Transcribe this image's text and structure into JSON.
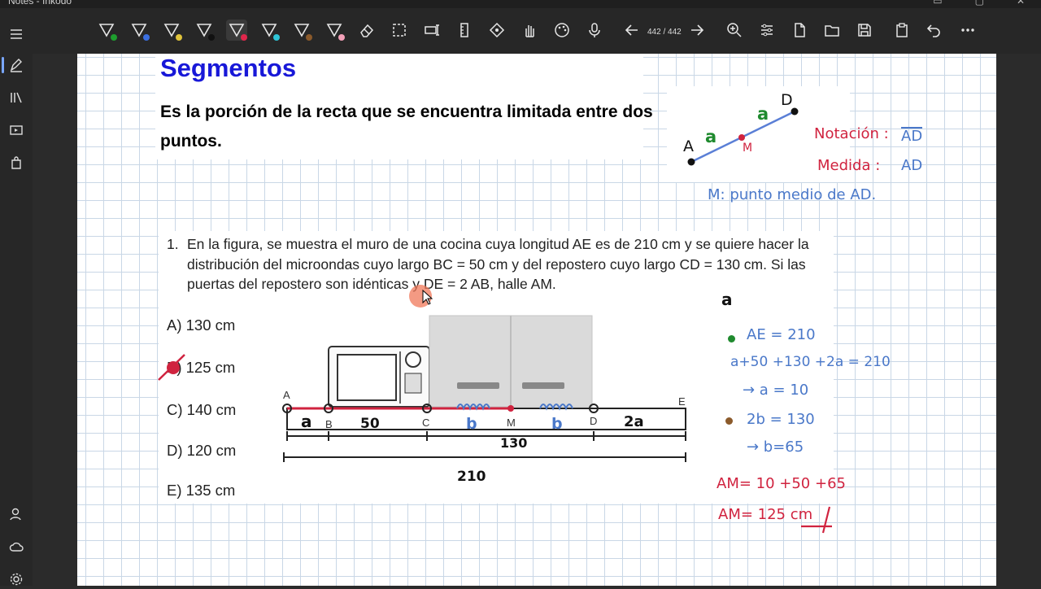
{
  "window": {
    "title": "Notes - Inkodo"
  },
  "toolbar": {
    "pens": [
      {
        "icon": "pen-icon",
        "color": "#1e9e2e"
      },
      {
        "icon": "pen-icon",
        "color": "#3b6fe0"
      },
      {
        "icon": "pen-icon",
        "color": "#e0c33b"
      },
      {
        "icon": "pen-icon",
        "color": "#111111"
      },
      {
        "icon": "pen-icon",
        "color": "#e0264b"
      },
      {
        "icon": "pen-icon",
        "color": "#2ec4d6"
      },
      {
        "icon": "pen-icon",
        "color": "#8b5a2b"
      },
      {
        "icon": "pen-icon",
        "color": "#f2a0b8"
      }
    ],
    "page_indicator": "442 / 442"
  },
  "content": {
    "heading": "Segmentos",
    "definition": "Es la porción de la recta que se encuentra limitada entre dos puntos.",
    "question_number": "1.",
    "question_text": "En la figura, se muestra el muro de una cocina cuya longitud AE es de 210 cm y se quiere hacer la distribución del microondas cuyo largo BC = 50 cm y del repostero cuyo largo CD = 130 cm. Si las puertas del repostero son idénticas y DE = 2 AB, halle AM.",
    "options": [
      {
        "letter": "A)",
        "text": "130 cm"
      },
      {
        "letter": "B)",
        "text": "125 cm"
      },
      {
        "letter": "C)",
        "text": "140 cm"
      },
      {
        "letter": "D)",
        "text": "120 cm"
      },
      {
        "letter": "E)",
        "text": "135 cm"
      }
    ],
    "figure_points": [
      "A",
      "B",
      "C",
      "M",
      "D",
      "E"
    ]
  },
  "handwriting": {
    "segment_labels": {
      "A": "A",
      "M": "M",
      "D": "D",
      "a1": "a",
      "a2": "a"
    },
    "notation_label": "Notación :",
    "notation_value": "AD",
    "measure_label": "Medida :",
    "measure_value": "AD",
    "midpoint_note": "M: punto medio de AD.",
    "under_ab": "a",
    "figure": {
      "a": "a",
      "fifty": "50",
      "b1": "b",
      "b2": "b",
      "two_a": "2a",
      "one30": "130",
      "two10": "210"
    },
    "solution": {
      "line1": "AE = 210",
      "line2": "a+50 +130 +2a = 210",
      "line3": "→ a = 10",
      "line4": "2b = 130",
      "line5": "→ b=65",
      "line6": "AM=  10 +50 +65",
      "line7": "AM= 125 cm"
    }
  },
  "colors": {
    "heading": "#1818d8",
    "ink_blue": "#4a78c9",
    "ink_red": "#d0233f",
    "ink_green": "#1f8a2e",
    "ink_brown": "#8b5a2b"
  }
}
